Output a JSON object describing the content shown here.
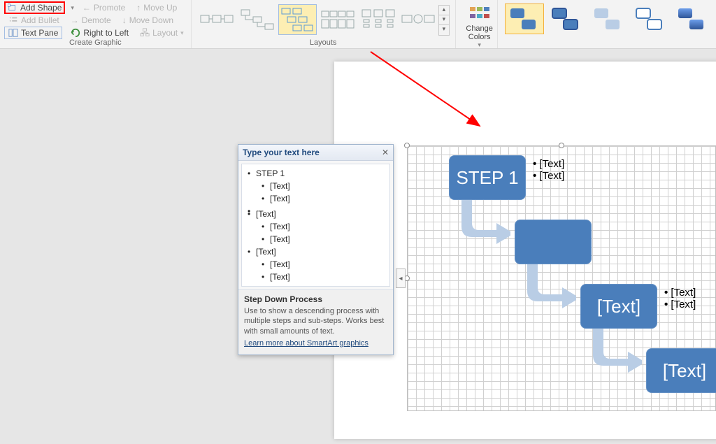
{
  "ribbon": {
    "create_graphic": {
      "label": "Create Graphic",
      "add_shape": "Add Shape",
      "add_bullet": "Add Bullet",
      "text_pane": "Text Pane",
      "promote": "Promote",
      "demote": "Demote",
      "right_to_left": "Right to Left",
      "move_up": "Move Up",
      "move_down": "Move Down",
      "layout": "Layout"
    },
    "layouts": {
      "label": "Layouts"
    },
    "change_colors": "Change Colors"
  },
  "text_pane": {
    "header": "Type your text here",
    "items": [
      {
        "level": 1,
        "text": "STEP 1"
      },
      {
        "level": 2,
        "text": "[Text]"
      },
      {
        "level": 2,
        "text": "[Text]"
      },
      {
        "level": 1,
        "text": ""
      },
      {
        "level": 1,
        "text": "[Text]"
      },
      {
        "level": 2,
        "text": "[Text]"
      },
      {
        "level": 2,
        "text": "[Text]"
      },
      {
        "level": 1,
        "text": "[Text]"
      },
      {
        "level": 2,
        "text": "[Text]"
      },
      {
        "level": 2,
        "text": "[Text]"
      }
    ],
    "footer_title": "Step Down Process",
    "footer_desc": "Use to show a descending process with multiple steps and sub-steps. Works best with small amounts of text.",
    "footer_link": "Learn more about SmartArt graphics"
  },
  "smartart": {
    "shapes": [
      {
        "label": "STEP 1",
        "bullets": [
          "[Text]",
          "[Text]"
        ]
      },
      {
        "label": "",
        "bullets": []
      },
      {
        "label": "[Text]",
        "bullets": [
          "[Text]",
          "[Text]"
        ]
      },
      {
        "label": "[Text]",
        "bullets": []
      }
    ]
  }
}
